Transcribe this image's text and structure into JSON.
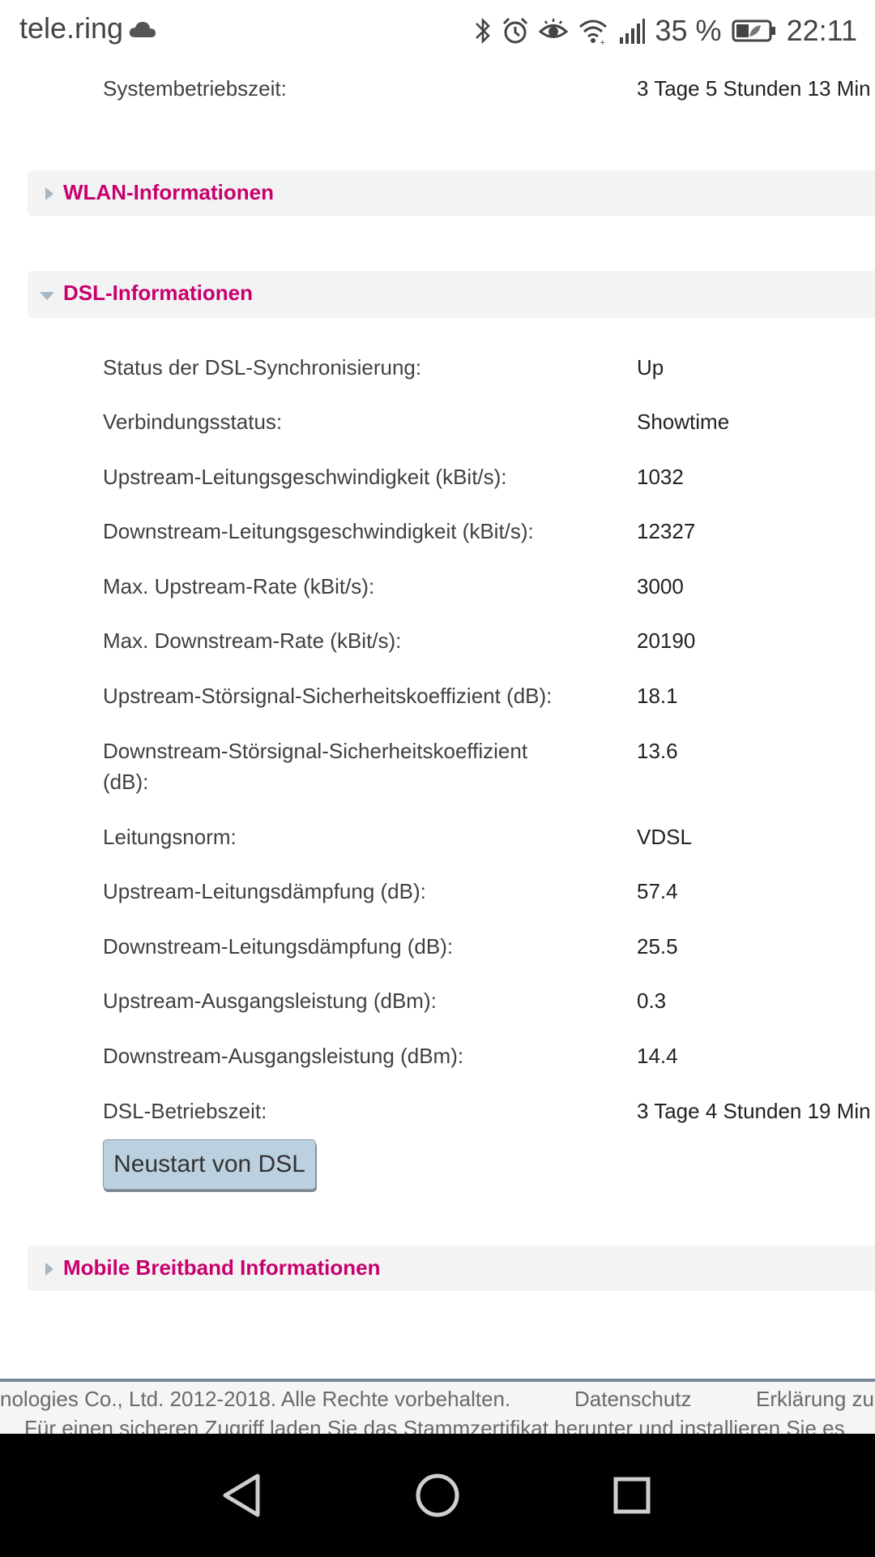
{
  "status_bar": {
    "carrier": "tele.ring",
    "battery_percent": "35 %",
    "time": "22:11",
    "icons": [
      "cloud-icon",
      "bluetooth-icon",
      "alarm-icon",
      "eye-icon",
      "wifi-icon",
      "signal-icon",
      "battery-icon"
    ]
  },
  "system": {
    "uptime_label": "Systembetriebszeit:",
    "uptime_value": "3 Tage 5 Stunden 13 Min"
  },
  "sections": {
    "wlan": "WLAN-Informationen",
    "dsl": "DSL-Informationen",
    "mobile": "Mobile Breitband Informationen"
  },
  "dsl": {
    "rows": [
      {
        "label": "Status der DSL-Synchronisierung:",
        "value": "Up"
      },
      {
        "label": "Verbindungsstatus:",
        "value": "Showtime"
      },
      {
        "label": "Upstream-Leitungsgeschwindigkeit (kBit/s):",
        "value": "1032"
      },
      {
        "label": "Downstream-Leitungsgeschwindigkeit (kBit/s):",
        "value": "12327"
      },
      {
        "label": "Max. Upstream-Rate (kBit/s):",
        "value": "3000"
      },
      {
        "label": "Max. Downstream-Rate (kBit/s):",
        "value": "20190"
      },
      {
        "label": "Upstream-Störsignal-Sicherheitskoeffizient (dB):",
        "value": "18.1"
      },
      {
        "label": "Downstream-Störsignal-Sicherheitskoeffizient",
        "label_line2": "(dB):",
        "value": "13.6"
      },
      {
        "label": "Leitungsnorm:",
        "value": "VDSL"
      },
      {
        "label": "Upstream-Leitungsdämpfung (dB):",
        "value": "57.4"
      },
      {
        "label": "Downstream-Leitungsdämpfung (dB):",
        "value": "25.5"
      },
      {
        "label": "Upstream-Ausgangsleistung (dBm):",
        "value": "0.3"
      },
      {
        "label": "Downstream-Ausgangsleistung (dBm):",
        "value": "14.4"
      },
      {
        "label": "DSL-Betriebszeit:",
        "value": "3 Tage 4 Stunden 19 Min"
      }
    ],
    "restart_button": "Neustart von DSL"
  },
  "footer": {
    "copyright": "nologies Co., Ltd. 2012-2018. Alle Rechte vorbehalten.",
    "privacy_link": "Datenschutz",
    "declaration_link": "Erklärung zu",
    "cert_notice": "Für einen sicheren Zugriff laden Sie das Stammzertifikat herunter und installieren Sie es"
  },
  "navigation": {
    "icons": [
      "back-icon",
      "home-icon",
      "recents-icon"
    ]
  },
  "colors": {
    "accent": "#c8006e",
    "section_bg": "#f3f3f3",
    "button_bg": "#bcd1e0"
  }
}
